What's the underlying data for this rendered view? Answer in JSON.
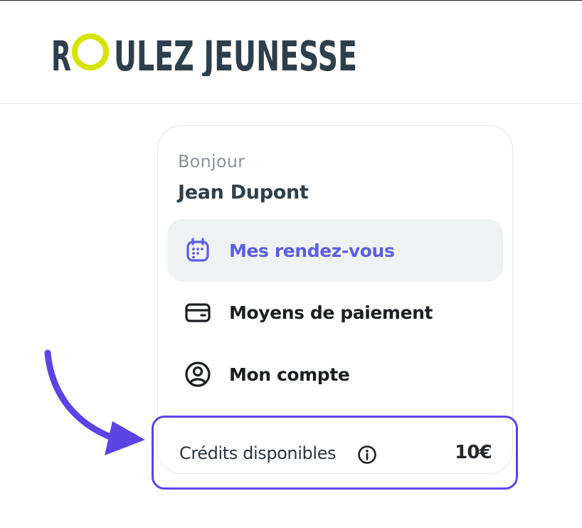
{
  "header": {
    "logo_text_before": "R",
    "logo_text_after": "ULEZ JEUNESSE",
    "logo_full": "ROULEZ JEUNESSE",
    "logo_color": "#2e3f4c",
    "logo_ring_color": "#d4e300"
  },
  "account_menu": {
    "greeting": "Bonjour",
    "user_name": "Jean Dupont",
    "items": [
      {
        "label": "Mes rendez-vous",
        "icon": "calendar-icon",
        "active": true
      },
      {
        "label": "Moyens de paiement",
        "icon": "wallet-icon",
        "active": false
      },
      {
        "label": "Mon compte",
        "icon": "user-circle-icon",
        "active": false
      }
    ],
    "active_color": "#5b5fe0"
  },
  "credits": {
    "label": "Crédits disponibles",
    "info_icon": "info-icon",
    "value": "10€",
    "highlight_color": "#5b43e6"
  },
  "annotation": {
    "arrow_icon": "arrow-icon",
    "arrow_color": "#5b43e6"
  }
}
